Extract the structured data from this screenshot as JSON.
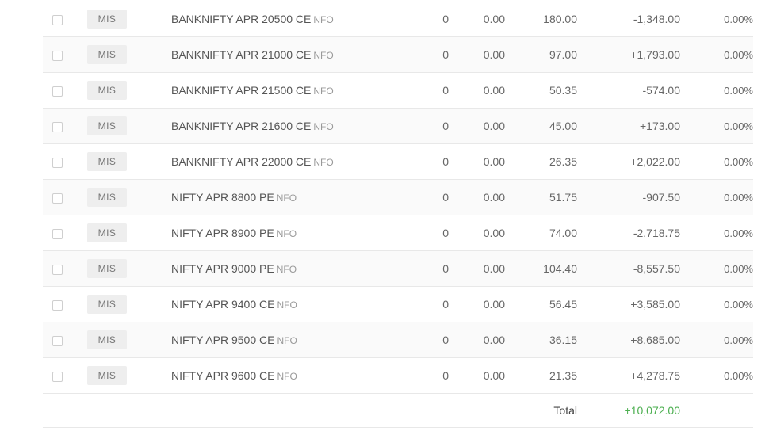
{
  "colors": {
    "positive": "#4caf50",
    "text": "#666666",
    "tag_bg": "#eeeeee"
  },
  "positions": [
    {
      "product": "MIS",
      "instrument": "BANKNIFTY APR 20500 CE",
      "exchange": "NFO",
      "qty": "0",
      "avg": "0.00",
      "ltp": "180.00",
      "pnl": "-1,348.00",
      "chg": "0.00%"
    },
    {
      "product": "MIS",
      "instrument": "BANKNIFTY APR 21000 CE",
      "exchange": "NFO",
      "qty": "0",
      "avg": "0.00",
      "ltp": "97.00",
      "pnl": "+1,793.00",
      "chg": "0.00%"
    },
    {
      "product": "MIS",
      "instrument": "BANKNIFTY APR 21500 CE",
      "exchange": "NFO",
      "qty": "0",
      "avg": "0.00",
      "ltp": "50.35",
      "pnl": "-574.00",
      "chg": "0.00%"
    },
    {
      "product": "MIS",
      "instrument": "BANKNIFTY APR 21600 CE",
      "exchange": "NFO",
      "qty": "0",
      "avg": "0.00",
      "ltp": "45.00",
      "pnl": "+173.00",
      "chg": "0.00%"
    },
    {
      "product": "MIS",
      "instrument": "BANKNIFTY APR 22000 CE",
      "exchange": "NFO",
      "qty": "0",
      "avg": "0.00",
      "ltp": "26.35",
      "pnl": "+2,022.00",
      "chg": "0.00%"
    },
    {
      "product": "MIS",
      "instrument": "NIFTY APR 8800 PE",
      "exchange": "NFO",
      "qty": "0",
      "avg": "0.00",
      "ltp": "51.75",
      "pnl": "-907.50",
      "chg": "0.00%"
    },
    {
      "product": "MIS",
      "instrument": "NIFTY APR 8900 PE",
      "exchange": "NFO",
      "qty": "0",
      "avg": "0.00",
      "ltp": "74.00",
      "pnl": "-2,718.75",
      "chg": "0.00%"
    },
    {
      "product": "MIS",
      "instrument": "NIFTY APR 9000 PE",
      "exchange": "NFO",
      "qty": "0",
      "avg": "0.00",
      "ltp": "104.40",
      "pnl": "-8,557.50",
      "chg": "0.00%"
    },
    {
      "product": "MIS",
      "instrument": "NIFTY APR 9400 CE",
      "exchange": "NFO",
      "qty": "0",
      "avg": "0.00",
      "ltp": "56.45",
      "pnl": "+3,585.00",
      "chg": "0.00%"
    },
    {
      "product": "MIS",
      "instrument": "NIFTY APR 9500 CE",
      "exchange": "NFO",
      "qty": "0",
      "avg": "0.00",
      "ltp": "36.15",
      "pnl": "+8,685.00",
      "chg": "0.00%"
    },
    {
      "product": "MIS",
      "instrument": "NIFTY APR 9600 CE",
      "exchange": "NFO",
      "qty": "0",
      "avg": "0.00",
      "ltp": "21.35",
      "pnl": "+4,278.75",
      "chg": "0.00%"
    }
  ],
  "total": {
    "label": "Total",
    "value": "+10,072.00"
  }
}
